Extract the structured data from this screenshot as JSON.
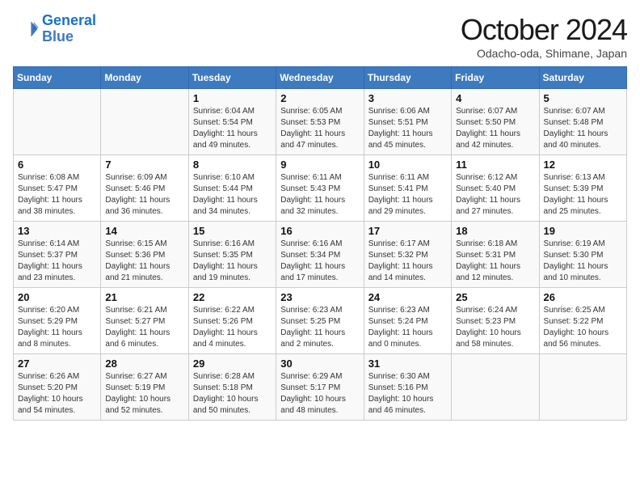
{
  "header": {
    "logo_line1": "General",
    "logo_line2": "Blue",
    "month_title": "October 2024",
    "subtitle": "Odacho-oda, Shimane, Japan"
  },
  "days_of_week": [
    "Sunday",
    "Monday",
    "Tuesday",
    "Wednesday",
    "Thursday",
    "Friday",
    "Saturday"
  ],
  "weeks": [
    [
      {
        "day": "",
        "info": ""
      },
      {
        "day": "",
        "info": ""
      },
      {
        "day": "1",
        "info": "Sunrise: 6:04 AM\nSunset: 5:54 PM\nDaylight: 11 hours and 49 minutes."
      },
      {
        "day": "2",
        "info": "Sunrise: 6:05 AM\nSunset: 5:53 PM\nDaylight: 11 hours and 47 minutes."
      },
      {
        "day": "3",
        "info": "Sunrise: 6:06 AM\nSunset: 5:51 PM\nDaylight: 11 hours and 45 minutes."
      },
      {
        "day": "4",
        "info": "Sunrise: 6:07 AM\nSunset: 5:50 PM\nDaylight: 11 hours and 42 minutes."
      },
      {
        "day": "5",
        "info": "Sunrise: 6:07 AM\nSunset: 5:48 PM\nDaylight: 11 hours and 40 minutes."
      }
    ],
    [
      {
        "day": "6",
        "info": "Sunrise: 6:08 AM\nSunset: 5:47 PM\nDaylight: 11 hours and 38 minutes."
      },
      {
        "day": "7",
        "info": "Sunrise: 6:09 AM\nSunset: 5:46 PM\nDaylight: 11 hours and 36 minutes."
      },
      {
        "day": "8",
        "info": "Sunrise: 6:10 AM\nSunset: 5:44 PM\nDaylight: 11 hours and 34 minutes."
      },
      {
        "day": "9",
        "info": "Sunrise: 6:11 AM\nSunset: 5:43 PM\nDaylight: 11 hours and 32 minutes."
      },
      {
        "day": "10",
        "info": "Sunrise: 6:11 AM\nSunset: 5:41 PM\nDaylight: 11 hours and 29 minutes."
      },
      {
        "day": "11",
        "info": "Sunrise: 6:12 AM\nSunset: 5:40 PM\nDaylight: 11 hours and 27 minutes."
      },
      {
        "day": "12",
        "info": "Sunrise: 6:13 AM\nSunset: 5:39 PM\nDaylight: 11 hours and 25 minutes."
      }
    ],
    [
      {
        "day": "13",
        "info": "Sunrise: 6:14 AM\nSunset: 5:37 PM\nDaylight: 11 hours and 23 minutes."
      },
      {
        "day": "14",
        "info": "Sunrise: 6:15 AM\nSunset: 5:36 PM\nDaylight: 11 hours and 21 minutes."
      },
      {
        "day": "15",
        "info": "Sunrise: 6:16 AM\nSunset: 5:35 PM\nDaylight: 11 hours and 19 minutes."
      },
      {
        "day": "16",
        "info": "Sunrise: 6:16 AM\nSunset: 5:34 PM\nDaylight: 11 hours and 17 minutes."
      },
      {
        "day": "17",
        "info": "Sunrise: 6:17 AM\nSunset: 5:32 PM\nDaylight: 11 hours and 14 minutes."
      },
      {
        "day": "18",
        "info": "Sunrise: 6:18 AM\nSunset: 5:31 PM\nDaylight: 11 hours and 12 minutes."
      },
      {
        "day": "19",
        "info": "Sunrise: 6:19 AM\nSunset: 5:30 PM\nDaylight: 11 hours and 10 minutes."
      }
    ],
    [
      {
        "day": "20",
        "info": "Sunrise: 6:20 AM\nSunset: 5:29 PM\nDaylight: 11 hours and 8 minutes."
      },
      {
        "day": "21",
        "info": "Sunrise: 6:21 AM\nSunset: 5:27 PM\nDaylight: 11 hours and 6 minutes."
      },
      {
        "day": "22",
        "info": "Sunrise: 6:22 AM\nSunset: 5:26 PM\nDaylight: 11 hours and 4 minutes."
      },
      {
        "day": "23",
        "info": "Sunrise: 6:23 AM\nSunset: 5:25 PM\nDaylight: 11 hours and 2 minutes."
      },
      {
        "day": "24",
        "info": "Sunrise: 6:23 AM\nSunset: 5:24 PM\nDaylight: 11 hours and 0 minutes."
      },
      {
        "day": "25",
        "info": "Sunrise: 6:24 AM\nSunset: 5:23 PM\nDaylight: 10 hours and 58 minutes."
      },
      {
        "day": "26",
        "info": "Sunrise: 6:25 AM\nSunset: 5:22 PM\nDaylight: 10 hours and 56 minutes."
      }
    ],
    [
      {
        "day": "27",
        "info": "Sunrise: 6:26 AM\nSunset: 5:20 PM\nDaylight: 10 hours and 54 minutes."
      },
      {
        "day": "28",
        "info": "Sunrise: 6:27 AM\nSunset: 5:19 PM\nDaylight: 10 hours and 52 minutes."
      },
      {
        "day": "29",
        "info": "Sunrise: 6:28 AM\nSunset: 5:18 PM\nDaylight: 10 hours and 50 minutes."
      },
      {
        "day": "30",
        "info": "Sunrise: 6:29 AM\nSunset: 5:17 PM\nDaylight: 10 hours and 48 minutes."
      },
      {
        "day": "31",
        "info": "Sunrise: 6:30 AM\nSunset: 5:16 PM\nDaylight: 10 hours and 46 minutes."
      },
      {
        "day": "",
        "info": ""
      },
      {
        "day": "",
        "info": ""
      }
    ]
  ]
}
